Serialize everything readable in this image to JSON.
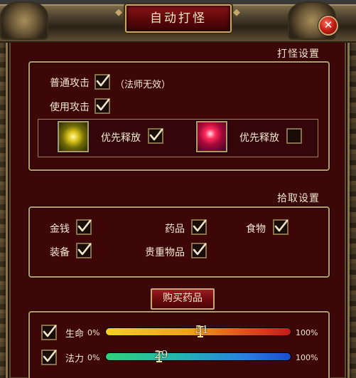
{
  "window": {
    "title": "自动打怪",
    "close_icon": "close-icon"
  },
  "combat": {
    "section_title": "打怪设置",
    "normal_attack": {
      "label": "普通攻击",
      "checked": true
    },
    "mage_note": "（法师无效）",
    "use_attack": {
      "label": "使用攻击",
      "checked": true
    },
    "skills": [
      {
        "icon": "lightning-skill-icon",
        "label": "优先释放",
        "checked": true,
        "color": "#d8c41a"
      },
      {
        "icon": "fire-skill-icon",
        "label": "优先释放",
        "checked": false,
        "color": "#ff2a5a"
      }
    ]
  },
  "pickup": {
    "section_title": "拾取设置",
    "items": [
      {
        "label": "金钱",
        "checked": true
      },
      {
        "label": "药品",
        "checked": true
      },
      {
        "label": "食物",
        "checked": true
      },
      {
        "label": "装备",
        "checked": true
      },
      {
        "label": "贵重物品",
        "checked": true
      }
    ]
  },
  "buy_button": "购买药品",
  "potions": [
    {
      "label": "生命",
      "checked": true,
      "min": "0%",
      "max": "100%",
      "value": 51,
      "value_text": "51",
      "color_from": "#f4d21e",
      "color_to": "#c81a1a"
    },
    {
      "label": "法力",
      "checked": true,
      "min": "0%",
      "max": "100%",
      "value": 29,
      "value_text": "29",
      "color_from": "#2fd27a",
      "color_to": "#1b4cd0"
    }
  ],
  "colors": {
    "panel": "#3b0708",
    "border_gold": "#b69a68",
    "check": "#f0e6cc"
  }
}
